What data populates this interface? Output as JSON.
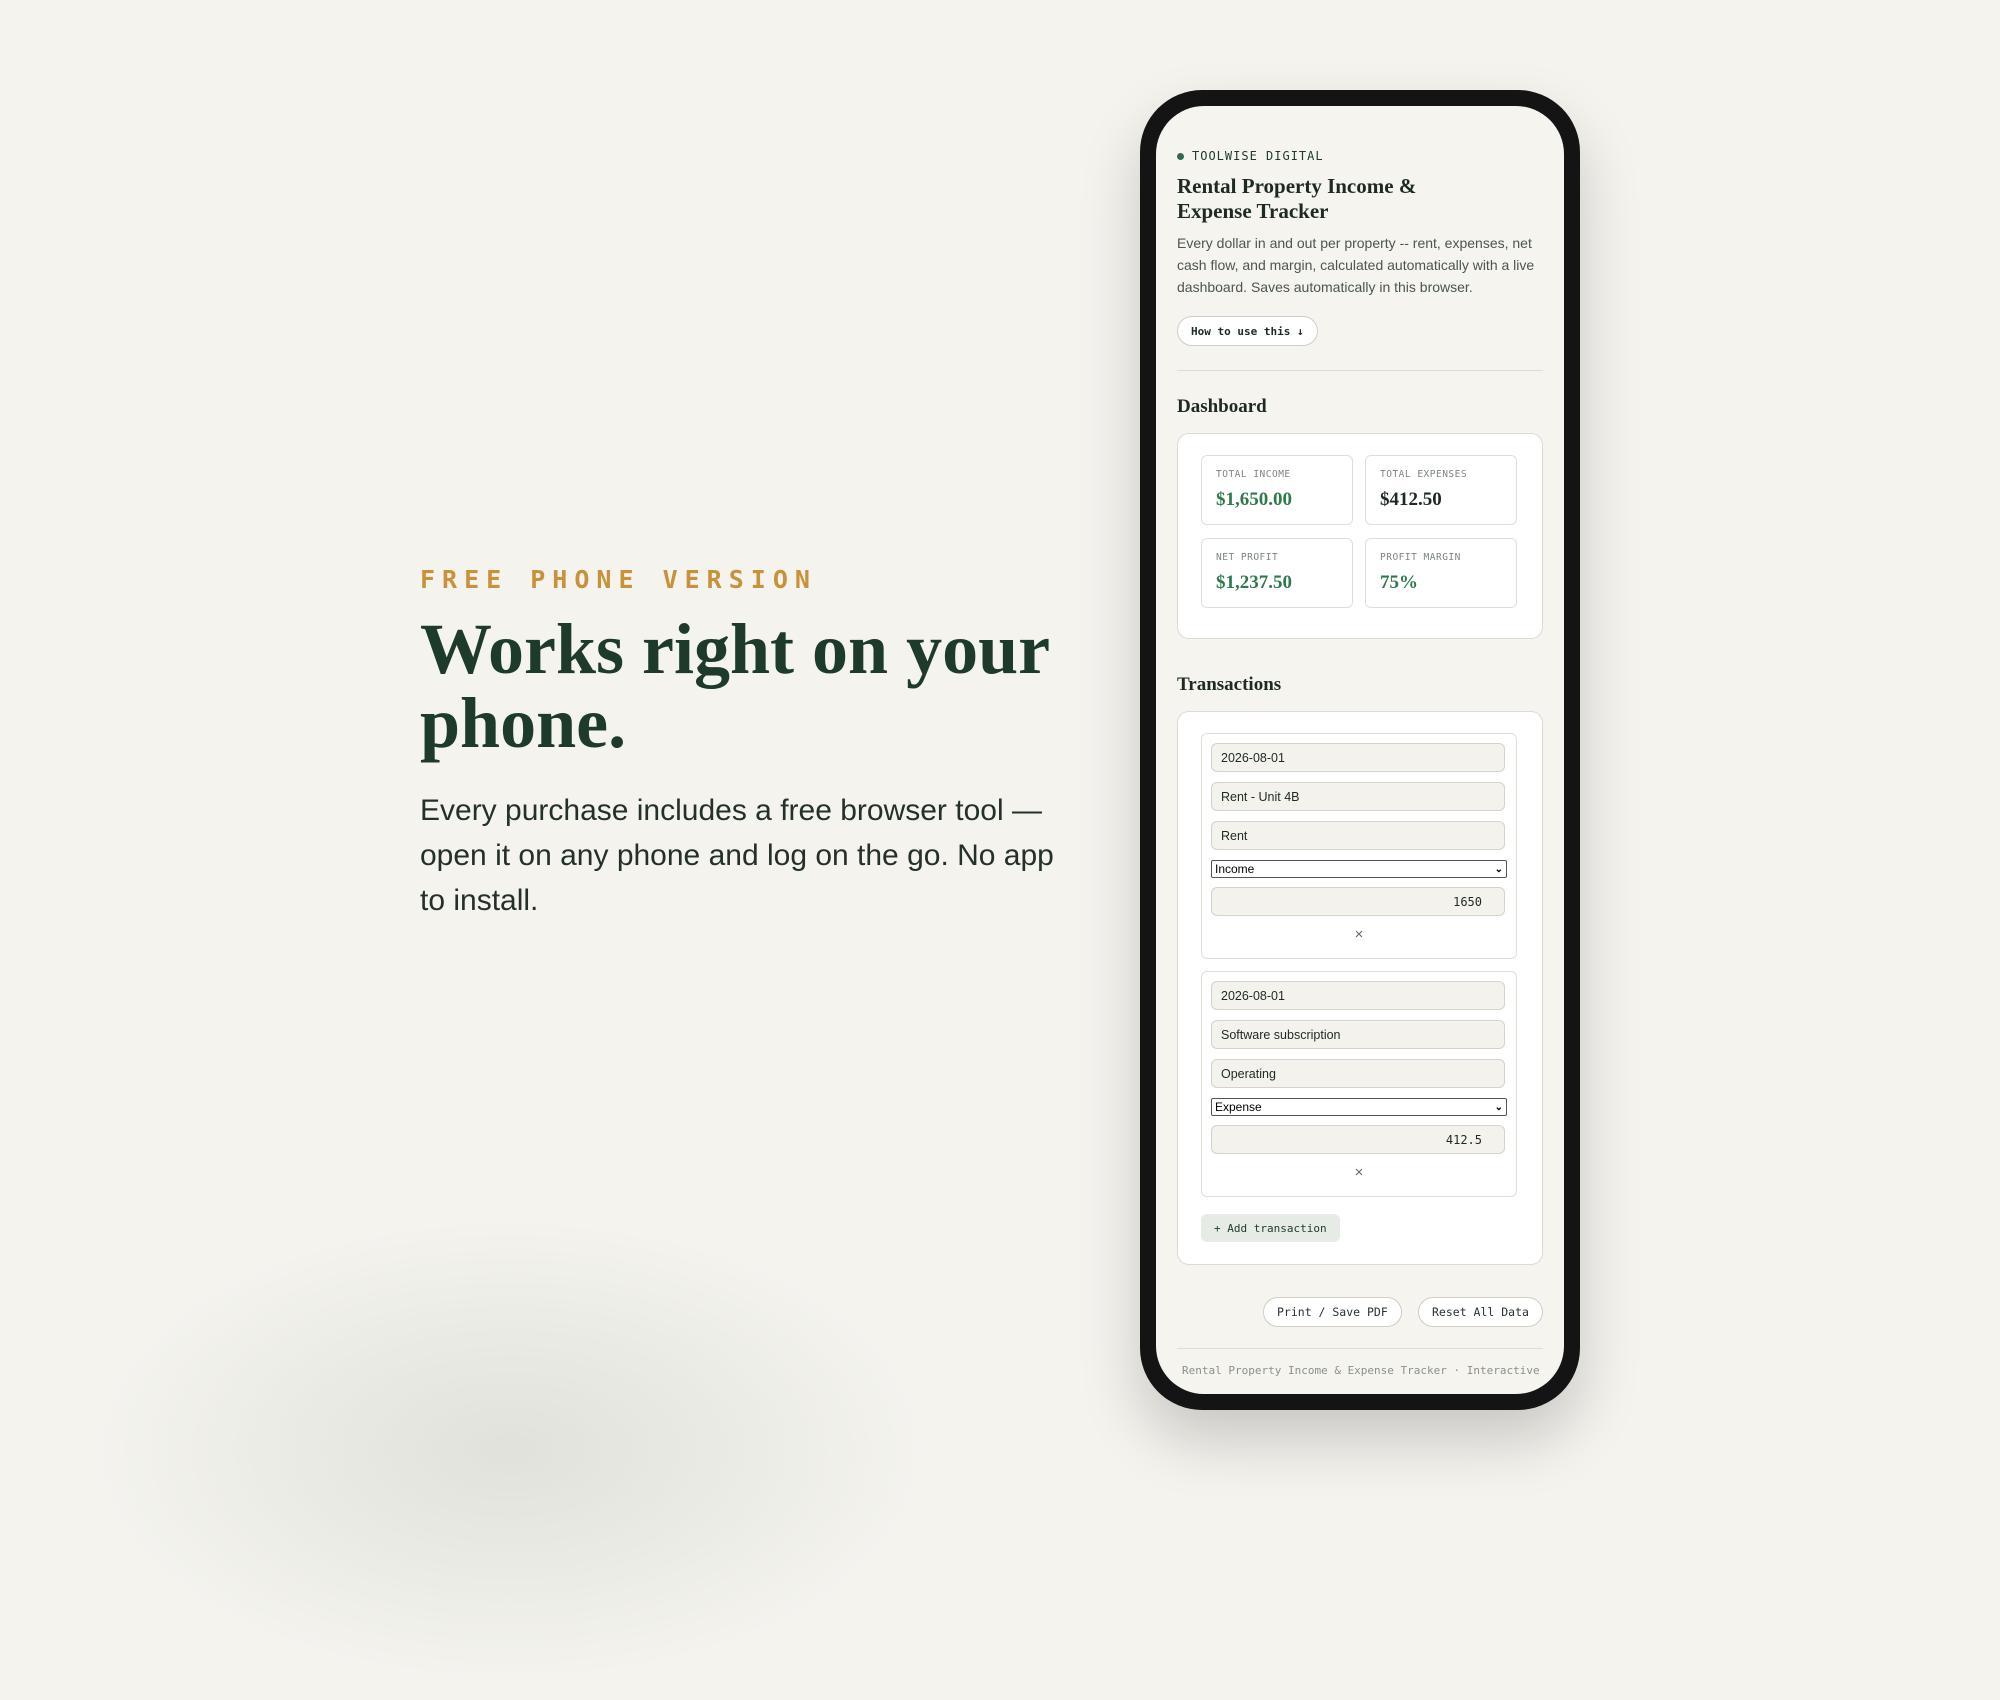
{
  "promo": {
    "eyebrow": "FREE PHONE VERSION",
    "headline": "Works right on your phone.",
    "subcopy": "Every purchase includes a free browser tool — open it on any phone and log on the go. No app to install."
  },
  "app": {
    "brand": "TOOLWISE DIGITAL",
    "title": "Rental Property Income & Expense Tracker",
    "description": "Every dollar in and out per property -- rent, expenses, net cash flow, and margin, calculated automatically with a live dashboard. Saves automatically in this browser.",
    "howto_label": "How to use this ↓"
  },
  "dashboard": {
    "title": "Dashboard",
    "stats": [
      {
        "label": "TOTAL INCOME",
        "value": "$1,650.00"
      },
      {
        "label": "TOTAL EXPENSES",
        "value": "$412.50"
      },
      {
        "label": "NET PROFIT",
        "value": "$1,237.50"
      },
      {
        "label": "PROFIT MARGIN",
        "value": "75%"
      }
    ]
  },
  "transactions": {
    "title": "Transactions",
    "items": [
      {
        "date": "2026-08-01",
        "description": "Rent - Unit 4B",
        "category": "Rent",
        "type": "Income",
        "amount": "1650",
        "remove": "×"
      },
      {
        "date": "2026-08-01",
        "description": "Software subscription",
        "category": "Operating",
        "type": "Expense",
        "amount": "412.5",
        "remove": "×"
      }
    ],
    "add_label": "+ Add transaction"
  },
  "actions": {
    "print_label": "Print / Save PDF",
    "reset_label": "Reset All Data"
  },
  "footer": {
    "text": "Rental Property Income & Expense Tracker · Interactive"
  },
  "colors": {
    "background": "#f4f3ee",
    "accent_gold": "#c8923a",
    "headline_green": "#1d3a2b",
    "positive_green": "#2f7a4d",
    "phone_frame": "#141414"
  },
  "icons": {
    "brand_dot": "dot-icon",
    "select_arrow": "chevron-down-icon",
    "remove": "close-icon"
  }
}
